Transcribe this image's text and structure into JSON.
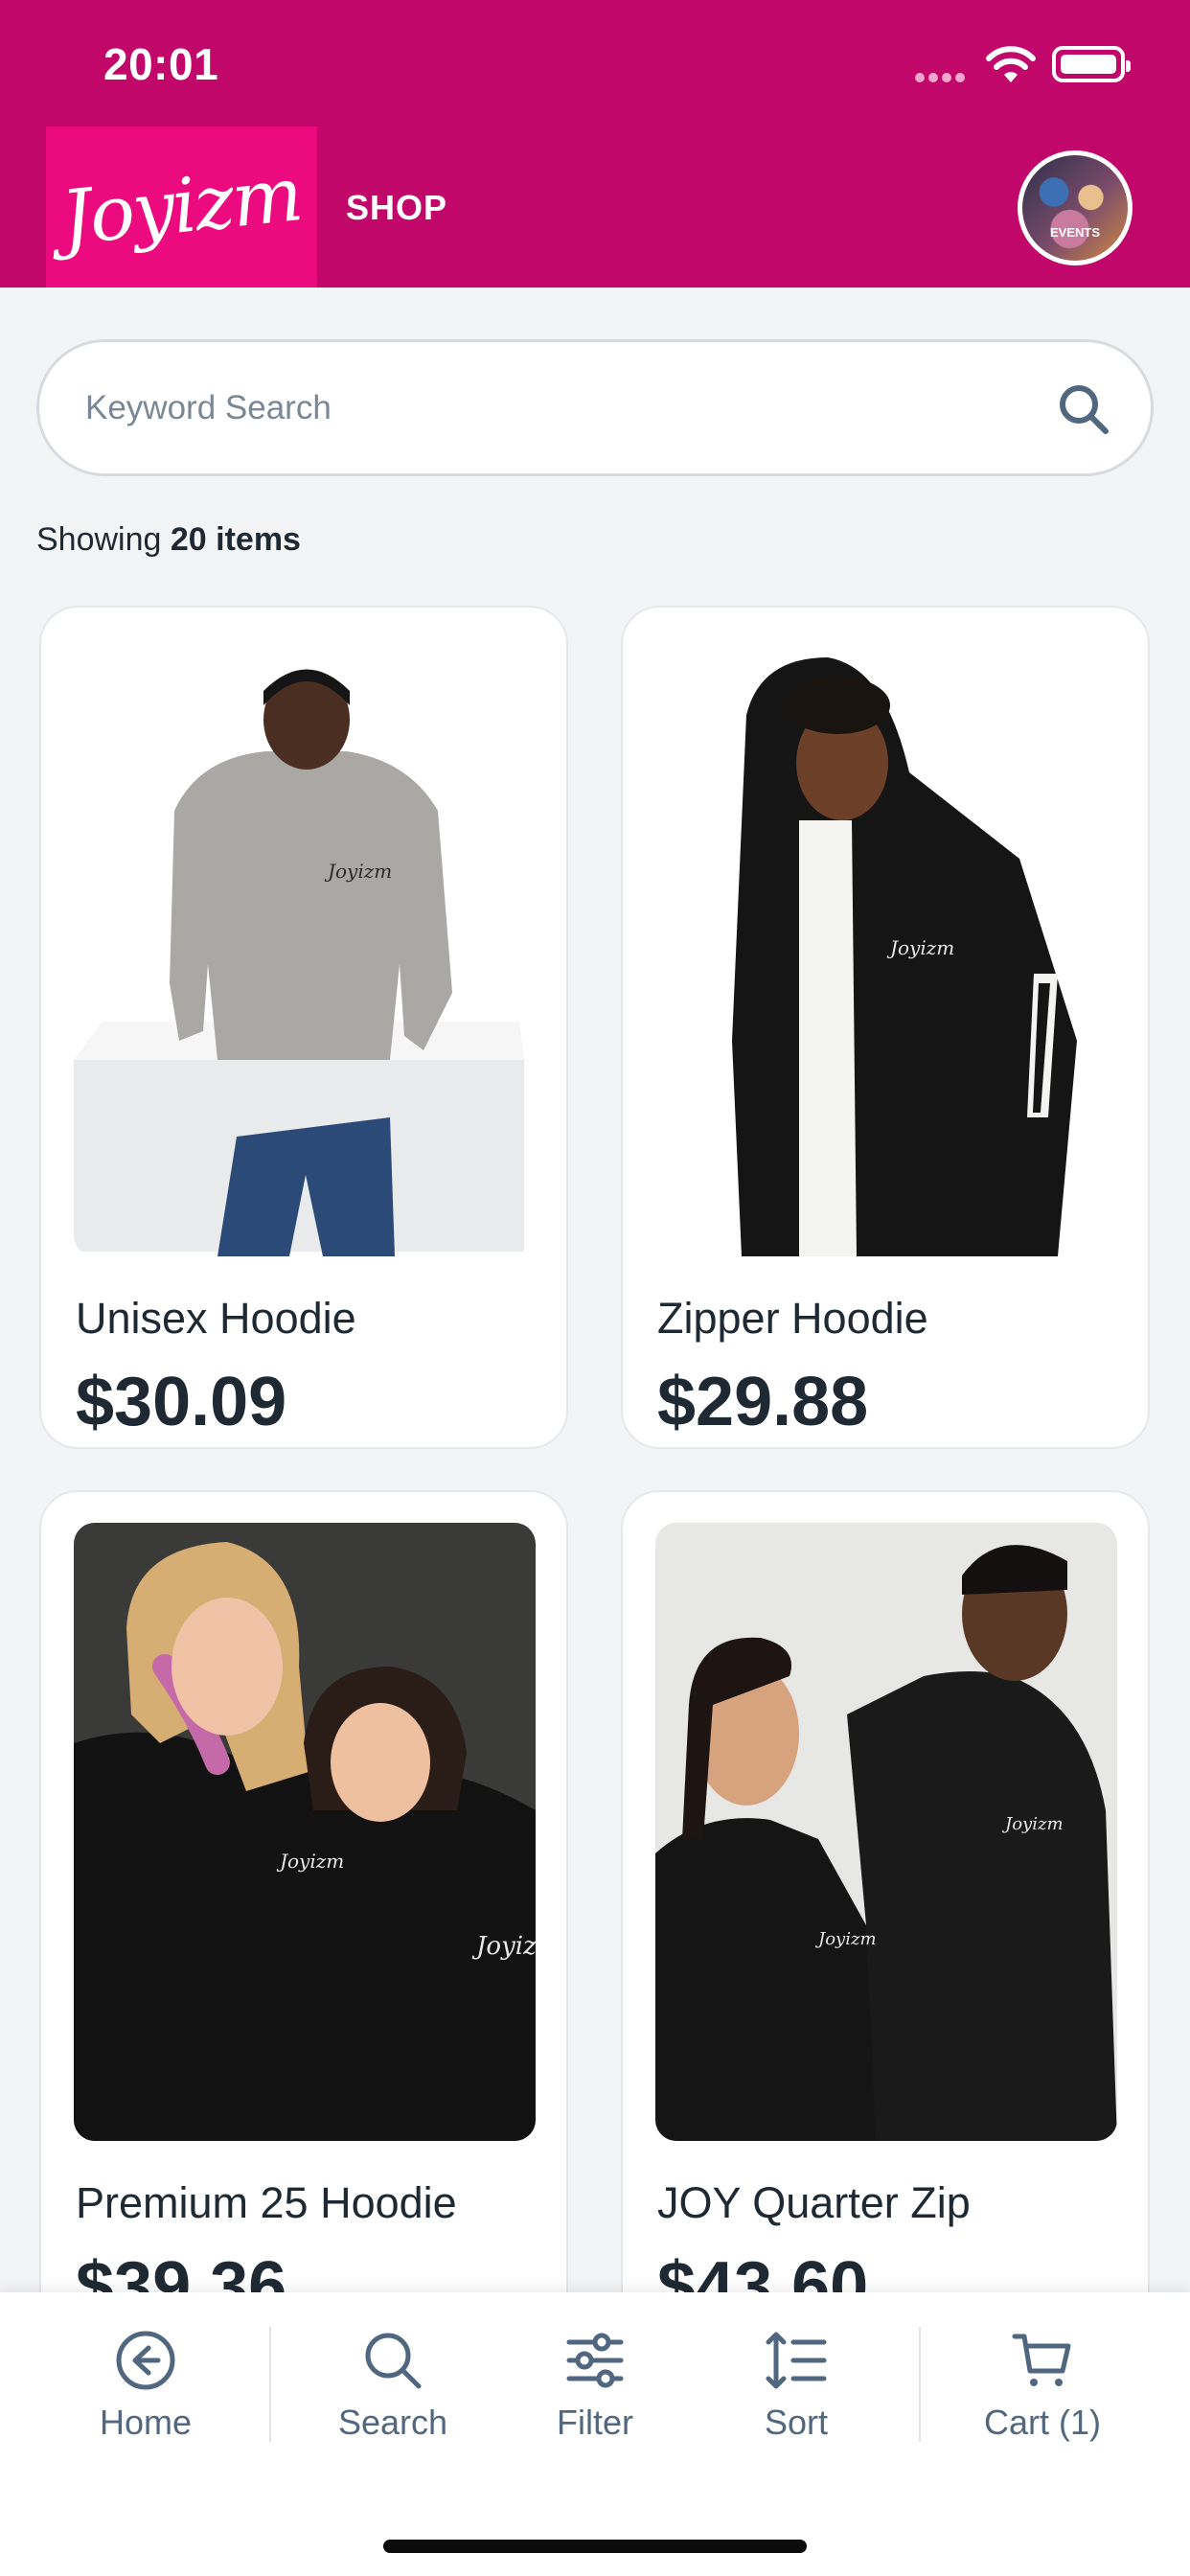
{
  "status_bar": {
    "time": "20:01"
  },
  "header": {
    "logo_text": "Joyizm",
    "nav_label": "SHOP",
    "avatar_label": "EVENTS"
  },
  "colors": {
    "brand": "#c2076a",
    "logo_bg": "#ec0a7f",
    "text": "#1f2933",
    "nav": "#51677f"
  },
  "search": {
    "placeholder": "Keyword Search",
    "value": ""
  },
  "results": {
    "prefix": "Showing",
    "count_text": "20 items"
  },
  "products": [
    {
      "name": "Unisex Hoodie",
      "price": "$30.09",
      "image": "man-gray-hoodie-photo"
    },
    {
      "name": "Zipper Hoodie",
      "price": "$29.88",
      "image": "man-black-zip-hoodie-photo"
    },
    {
      "name": "Premium 25 Hoodie",
      "price": "$39.36",
      "image": "two-women-black-hoodies-photo"
    },
    {
      "name": "JOY Quarter Zip",
      "price": "$43.60",
      "image": "couple-quarter-zip-photo"
    }
  ],
  "bottom_nav": [
    {
      "label": "Home",
      "icon": "arrow-left-circle-icon"
    },
    {
      "label": "Search",
      "icon": "search-icon"
    },
    {
      "label": "Filter",
      "icon": "sliders-icon"
    },
    {
      "label": "Sort",
      "icon": "sort-icon"
    },
    {
      "label": "Cart (1)",
      "icon": "cart-icon"
    }
  ]
}
